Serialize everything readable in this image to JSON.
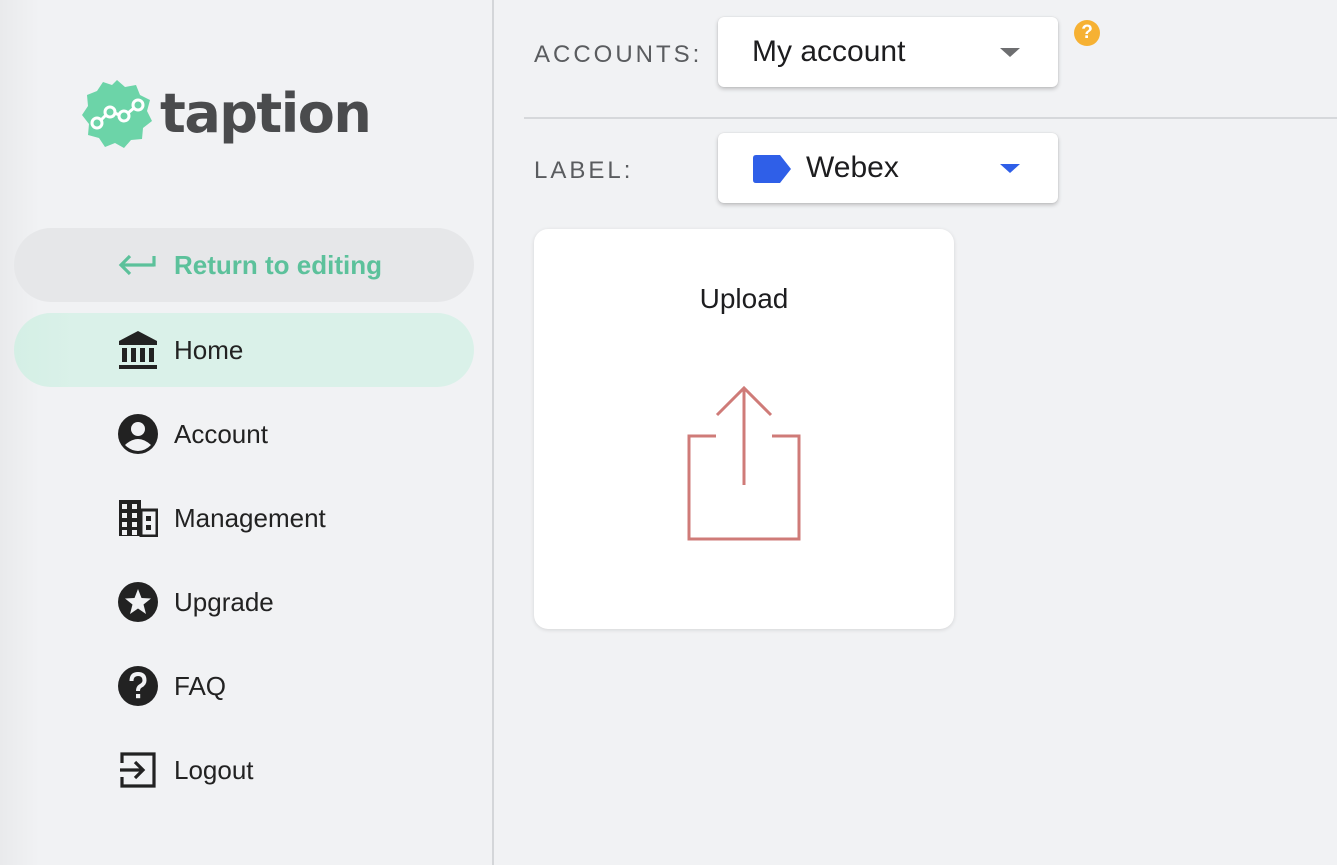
{
  "brand": {
    "name": "taption",
    "accent": "#5cc19b",
    "logo_color": "#6cd4a8"
  },
  "sidebar": {
    "return_label": "Return to editing",
    "items": [
      {
        "label": "Home",
        "icon": "bank-icon",
        "active": true
      },
      {
        "label": "Account",
        "icon": "account-circle-icon"
      },
      {
        "label": "Management",
        "icon": "building-icon"
      },
      {
        "label": "Upgrade",
        "icon": "star-circle-icon"
      },
      {
        "label": "FAQ",
        "icon": "help-circle-icon"
      },
      {
        "label": "Logout",
        "icon": "logout-icon"
      }
    ]
  },
  "header": {
    "accounts_label": "ACCOUNTS:",
    "accounts_value": "My account",
    "label_label": "LABEL:",
    "label_value": "Webex",
    "label_color": "#2f5fe8",
    "help_glyph": "?"
  },
  "upload": {
    "title": "Upload",
    "icon_color": "#cf7b78"
  }
}
